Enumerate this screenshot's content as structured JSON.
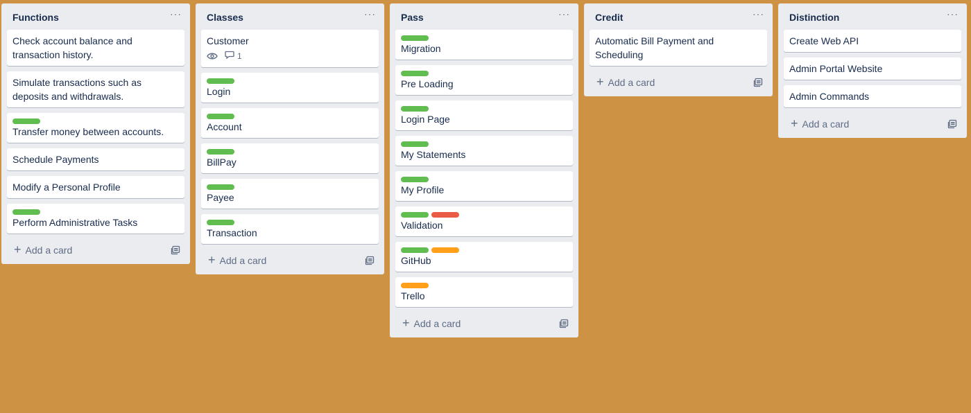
{
  "board": {
    "colors": {
      "background": "#cd9243",
      "green": "#61bd4f",
      "red": "#eb5a46",
      "orange": "#ff9f1a"
    },
    "add_card_label": "Add a card",
    "menu_glyph": "···",
    "lists": [
      {
        "title": "Functions",
        "cards": [
          {
            "title": "Check account balance and transaction history.",
            "labels": []
          },
          {
            "title": "Simulate transactions such as deposits and withdrawals.",
            "labels": []
          },
          {
            "title": "Transfer money between accounts.",
            "labels": [
              "green"
            ]
          },
          {
            "title": "Schedule Payments",
            "labels": []
          },
          {
            "title": "Modify a Personal Profile",
            "labels": []
          },
          {
            "title": "Perform Administrative Tasks",
            "labels": [
              "green"
            ]
          }
        ]
      },
      {
        "title": "Classes",
        "cards": [
          {
            "title": "Customer",
            "labels": [],
            "badges": {
              "watch": true,
              "comments": "1"
            }
          },
          {
            "title": "Login",
            "labels": [
              "green"
            ]
          },
          {
            "title": "Account",
            "labels": [
              "green"
            ]
          },
          {
            "title": "BillPay",
            "labels": [
              "green"
            ]
          },
          {
            "title": "Payee",
            "labels": [
              "green"
            ]
          },
          {
            "title": "Transaction",
            "labels": [
              "green"
            ]
          }
        ]
      },
      {
        "title": "Pass",
        "cards": [
          {
            "title": "Migration",
            "labels": [
              "green"
            ]
          },
          {
            "title": "Pre Loading",
            "labels": [
              "green"
            ]
          },
          {
            "title": "Login Page",
            "labels": [
              "green"
            ]
          },
          {
            "title": "My Statements",
            "labels": [
              "green"
            ]
          },
          {
            "title": "My Profile",
            "labels": [
              "green"
            ]
          },
          {
            "title": "Validation",
            "labels": [
              "green",
              "red"
            ]
          },
          {
            "title": "GitHub",
            "labels": [
              "green",
              "orange"
            ]
          },
          {
            "title": "Trello",
            "labels": [
              "orange"
            ]
          }
        ]
      },
      {
        "title": "Credit",
        "cards": [
          {
            "title": "Automatic Bill Payment and Scheduling",
            "labels": []
          }
        ]
      },
      {
        "title": "Distinction",
        "cards": [
          {
            "title": "Create Web API",
            "labels": []
          },
          {
            "title": "Admin Portal Website",
            "labels": []
          },
          {
            "title": "Admin Commands",
            "labels": []
          }
        ]
      }
    ]
  }
}
